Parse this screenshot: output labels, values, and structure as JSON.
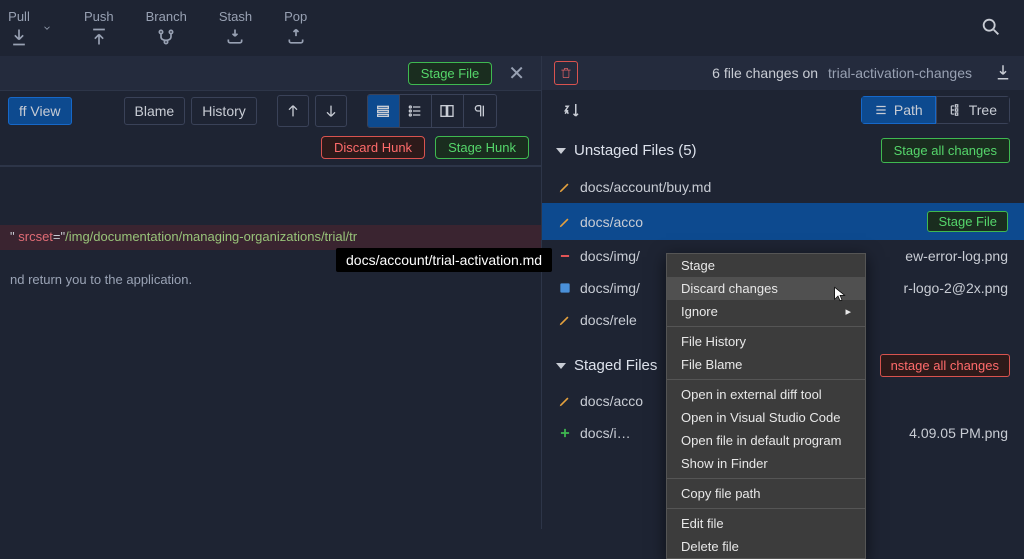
{
  "toolbar": {
    "pull": "Pull",
    "push": "Push",
    "branch": "Branch",
    "stash": "Stash",
    "pop": "Pop"
  },
  "subbar": {
    "stage_file": "Stage File"
  },
  "tabs": {
    "diff_view": "ff View",
    "blame": "Blame",
    "history": "History"
  },
  "hunk": {
    "discard": "Discard Hunk",
    "stage": "Stage Hunk"
  },
  "diff": {
    "tooltip_path": "docs/account/trial-activation.md",
    "line1_prefix": "\" ",
    "line1_attr": "srcset",
    "line1_mid": "=\"",
    "line1_val": "/img/documentation/managing-organizations/trial/tr",
    "line2": "nd return you to the application."
  },
  "right": {
    "changes_text": "6 file changes on",
    "branch": "trial-activation-changes",
    "path_label": "Path",
    "tree_label": "Tree",
    "unstaged_label": "Unstaged Files (5)",
    "stage_all": "Stage all changes",
    "staged_label": "Staged Files",
    "unstage_all": "nstage all changes",
    "stage_file_btn": "Stage File",
    "files": {
      "f0": "docs/account/buy.md",
      "f1": "docs/acco",
      "f2": "docs/img/",
      "f2_suffix": "ew-error-log.png",
      "f3": "docs/img/",
      "f3_suffix": "r-logo-2@2x.png",
      "f4": "docs/rele",
      "f5": "docs/acco",
      "f6": "docs/i…",
      "f6_suffix": "4.09.05 PM.png"
    }
  },
  "context_menu": {
    "stage": "Stage",
    "discard": "Discard changes",
    "ignore": "Ignore",
    "file_history": "File History",
    "file_blame": "File Blame",
    "open_diff": "Open in external diff tool",
    "open_vscode": "Open in Visual Studio Code",
    "open_default": "Open file in default program",
    "show_finder": "Show in Finder",
    "copy_path": "Copy file path",
    "edit_file": "Edit file",
    "delete_file": "Delete file"
  }
}
